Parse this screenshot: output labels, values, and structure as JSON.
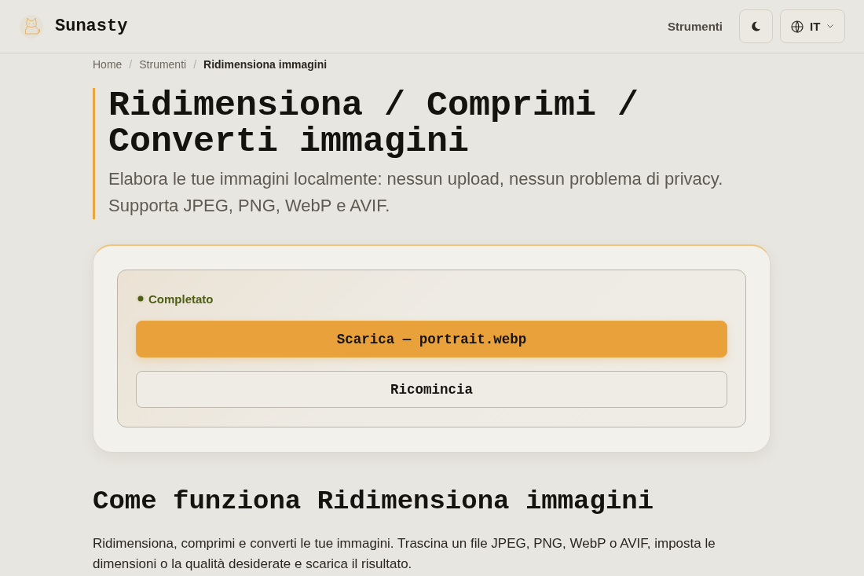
{
  "header": {
    "brand": "Sunasty",
    "nav": [
      {
        "label": "Strumenti"
      }
    ],
    "language": {
      "label": "IT"
    }
  },
  "breadcrumb": {
    "separator": "/",
    "items": [
      {
        "label": "Home",
        "current": false
      },
      {
        "label": "Strumenti",
        "current": false
      },
      {
        "label": "Ridimensiona immagini",
        "current": true
      }
    ]
  },
  "hero": {
    "title": "Ridimensiona / Comprimi / Converti immagini",
    "subtitle": "Elabora le tue immagini localmente: nessun upload, nessun problema di privacy. Supporta JPEG, PNG, WebP e AVIF."
  },
  "result": {
    "status": {
      "label": "Completato",
      "kind": "success"
    },
    "actions": [
      {
        "label": "Scarica — portrait.webp",
        "kind": "primary"
      },
      {
        "label": "Ricomincia",
        "kind": "secondary"
      }
    ]
  },
  "how_it_works": {
    "heading": "Come funziona Ridimensiona immagini",
    "text": "Ridimensiona, comprimi e converti le tue immagini. Trascina un file JPEG, PNG, WebP o AVIF, imposta le dimensioni o la qualità desiderate e scarica il risultato."
  }
}
